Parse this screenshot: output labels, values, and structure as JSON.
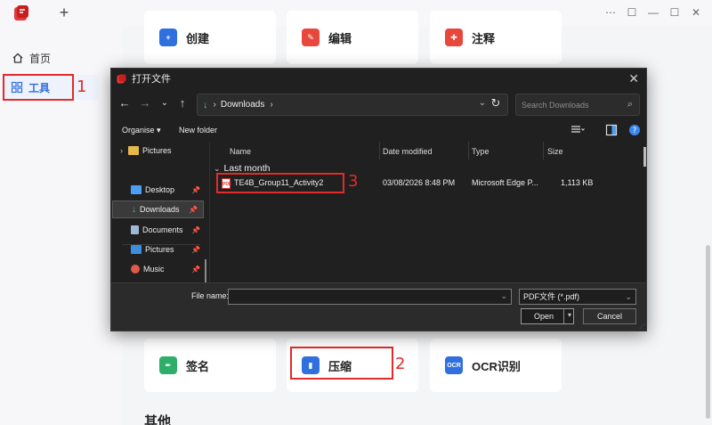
{
  "app": {
    "new_tab_symbol": "+",
    "window_controls": [
      "⋯",
      "☐",
      "—",
      "☐",
      "✕"
    ]
  },
  "sidebar": {
    "items": [
      {
        "label": "首页",
        "icon": "home-icon"
      },
      {
        "label": "工具",
        "icon": "grid-icon",
        "selected": true
      }
    ]
  },
  "annotations": {
    "n1": "1",
    "n2": "2",
    "n3": "3"
  },
  "main": {
    "top_cards": [
      {
        "label": "创建",
        "icon": "create-icon",
        "color": "#2f6fde"
      },
      {
        "label": "编辑",
        "icon": "edit-icon",
        "color": "#e8473b"
      },
      {
        "label": "注释",
        "icon": "comment-icon",
        "color": "#e8473b"
      }
    ],
    "bottom_cards": [
      {
        "label": "签名",
        "icon": "sign-icon",
        "color": "#2fae6a"
      },
      {
        "label": "压缩",
        "icon": "compress-icon",
        "color": "#2f6fde"
      },
      {
        "label": "OCR识别",
        "icon": "ocr-icon",
        "color": "#2f6fde",
        "badge": "OCR"
      }
    ],
    "section_other": "其他"
  },
  "dialog": {
    "title": "打开文件",
    "address": {
      "folder": "Downloads"
    },
    "search_placeholder": "Search Downloads",
    "toolbar": {
      "organise": "Organise ▾",
      "new_folder": "New folder"
    },
    "nav_items": [
      {
        "label": "Pictures",
        "icon": "folder-icon",
        "pinned": false
      },
      {
        "label": "Desktop",
        "icon": "desktop-icon",
        "pinned": true
      },
      {
        "label": "Downloads",
        "icon": "downloads-icon",
        "pinned": true,
        "selected": true
      },
      {
        "label": "Documents",
        "icon": "documents-icon",
        "pinned": true
      },
      {
        "label": "Pictures",
        "icon": "pictures-icon",
        "pinned": true
      },
      {
        "label": "Music",
        "icon": "music-icon",
        "pinned": true
      }
    ],
    "columns": [
      "Name",
      "Date modified",
      "Type",
      "Size"
    ],
    "group": "Last month",
    "files": [
      {
        "name": "TE4B_Group11_Activity2",
        "date": "03/08/2026 8:48 PM",
        "type": "Microsoft Edge P...",
        "size": "1,113 KB",
        "icon_text": "PDF"
      }
    ],
    "file_name_label": "File name:",
    "file_name_value": "",
    "file_type": "PDF文件 (*.pdf)",
    "open_label": "Open",
    "cancel_label": "Cancel"
  }
}
